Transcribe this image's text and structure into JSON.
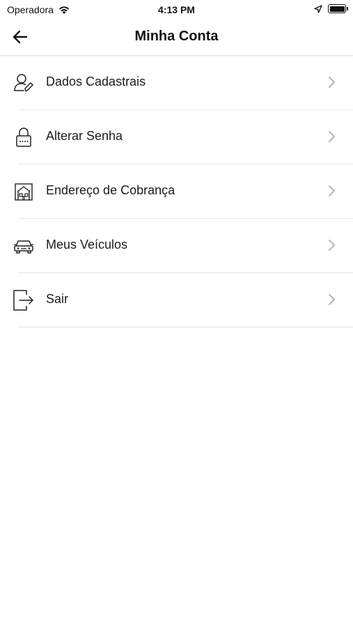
{
  "status_bar": {
    "carrier": "Operadora",
    "time": "4:13 PM"
  },
  "header": {
    "title": "Minha Conta",
    "back_icon": "arrow-left-icon"
  },
  "menu": {
    "items": [
      {
        "label": "Dados Cadastrais",
        "icon": "user-edit-icon"
      },
      {
        "label": "Alterar Senha",
        "icon": "lock-icon"
      },
      {
        "label": "Endereço de Cobrança",
        "icon": "house-icon"
      },
      {
        "label": "Meus Veículos",
        "icon": "car-icon"
      },
      {
        "label": "Sair",
        "icon": "logout-icon"
      }
    ]
  }
}
